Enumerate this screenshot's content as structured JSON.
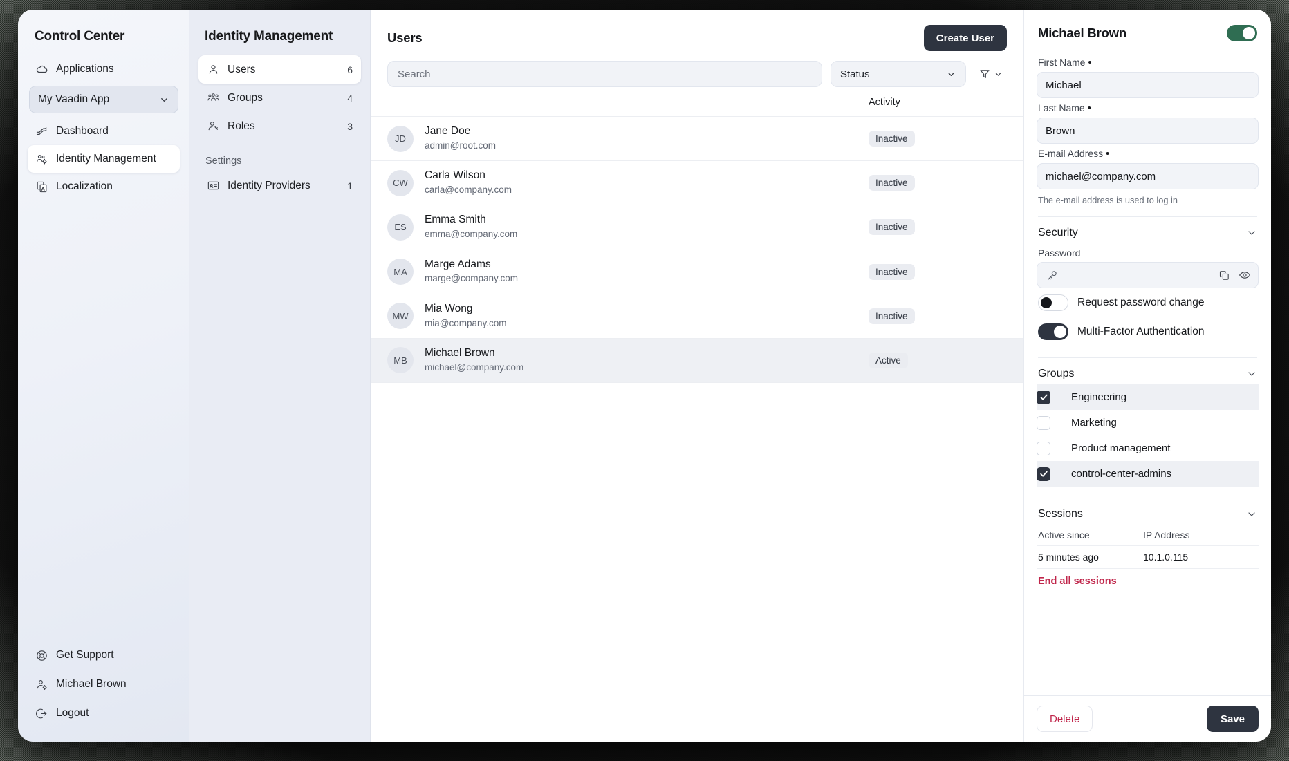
{
  "control_center": {
    "title": "Control Center",
    "applications_label": "Applications",
    "app_selector_value": "My Vaadin App",
    "items": [
      {
        "label": "Dashboard",
        "icon": "dashboard-icon",
        "selected": false
      },
      {
        "label": "Identity Management",
        "icon": "identity-icon",
        "selected": true
      },
      {
        "label": "Localization",
        "icon": "localization-icon",
        "selected": false
      }
    ],
    "footer": [
      {
        "label": "Get Support",
        "icon": "support-icon"
      },
      {
        "label": "Michael Brown",
        "icon": "user-gear-icon"
      },
      {
        "label": "Logout",
        "icon": "logout-icon"
      }
    ]
  },
  "identity_nav": {
    "title": "Identity Management",
    "items": [
      {
        "label": "Users",
        "count": "6",
        "icon": "user-icon",
        "selected": true
      },
      {
        "label": "Groups",
        "count": "4",
        "icon": "groups-icon",
        "selected": false
      },
      {
        "label": "Roles",
        "count": "3",
        "icon": "role-icon",
        "selected": false
      }
    ],
    "settings_label": "Settings",
    "settings_items": [
      {
        "label": "Identity Providers",
        "count": "1",
        "icon": "id-card-icon"
      }
    ]
  },
  "users_view": {
    "title": "Users",
    "create_button": "Create User",
    "search_placeholder": "Search",
    "search_value": "",
    "status_filter_value": "Status",
    "column_activity": "Activity",
    "rows": [
      {
        "initials": "JD",
        "name": "Jane Doe",
        "email": "admin@root.com",
        "status": "Inactive",
        "selected": false
      },
      {
        "initials": "CW",
        "name": "Carla Wilson",
        "email": "carla@company.com",
        "status": "Inactive",
        "selected": false
      },
      {
        "initials": "ES",
        "name": "Emma Smith",
        "email": "emma@company.com",
        "status": "Inactive",
        "selected": false
      },
      {
        "initials": "MA",
        "name": "Marge Adams",
        "email": "marge@company.com",
        "status": "Inactive",
        "selected": false
      },
      {
        "initials": "MW",
        "name": "Mia Wong",
        "email": "mia@company.com",
        "status": "Inactive",
        "selected": false
      },
      {
        "initials": "MB",
        "name": "Michael Brown",
        "email": "michael@company.com",
        "status": "Active",
        "selected": true
      }
    ]
  },
  "detail": {
    "title": "Michael Brown",
    "enabled_toggle": true,
    "first_name_label": "First Name",
    "first_name_value": "Michael",
    "last_name_label": "Last Name",
    "last_name_value": "Brown",
    "email_label": "E-mail Address",
    "email_value": "michael@company.com",
    "email_help": "The e-mail address is used to log in",
    "security": {
      "title": "Security",
      "password_label": "Password",
      "password_value": "",
      "request_password_change_label": "Request password change",
      "request_password_change_on": false,
      "mfa_label": "Multi-Factor Authentication",
      "mfa_on": true
    },
    "groups": {
      "title": "Groups",
      "items": [
        {
          "label": "Engineering",
          "checked": true
        },
        {
          "label": "Marketing",
          "checked": false
        },
        {
          "label": "Product management",
          "checked": false
        },
        {
          "label": "control-center-admins",
          "checked": true
        }
      ]
    },
    "sessions": {
      "title": "Sessions",
      "header_active_since": "Active since",
      "header_ip": "IP Address",
      "rows": [
        {
          "active_since": "5 minutes ago",
          "ip": "10.1.0.115"
        }
      ],
      "end_all_label": "End all sessions"
    },
    "delete_button": "Delete",
    "save_button": "Save"
  },
  "colors": {
    "accent_dark": "#2e3440",
    "toggle_green": "#2f6d52",
    "danger": "#c0264b",
    "panel_bg": "#e9ecf4"
  }
}
